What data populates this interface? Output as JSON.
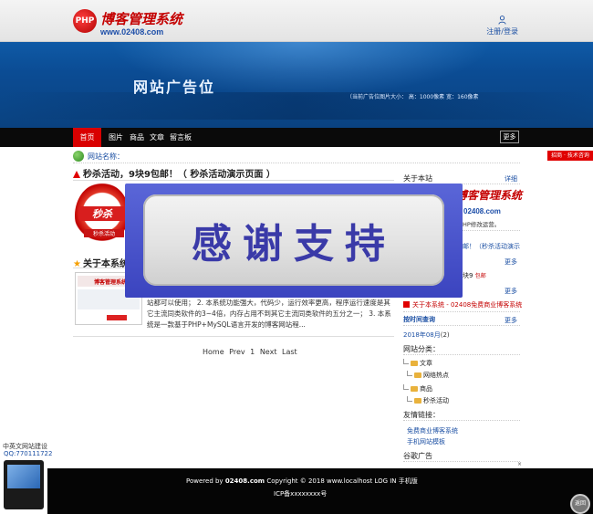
{
  "header": {
    "logo_badge": "PHP",
    "logo_title": "博客管理系统",
    "logo_url": "www.02408.com",
    "login": "注册/登录"
  },
  "banner": {
    "title": "网站广告位",
    "info": "（当前广告位图片大小：   高：1000像素     宽：160像素"
  },
  "nav": {
    "items": [
      "首页",
      "图片",
      "商品",
      "文章",
      "留言板"
    ],
    "more": "更多"
  },
  "breadcrumb": {
    "label": "网站名称：",
    "ad": "招商 · 技术咨询"
  },
  "article": {
    "title": "秒杀活动，9块9包邮！（ 秒杀活动演示页面 ）",
    "seckill_big": "秒杀",
    "seckill_small": "秒杀活动",
    "about_title": "关于本系统",
    "about_text": "站都可以使用； 2. 本系统功能强大，代码少，运行效率更高，程序运行速度是其它主流同类软件的3~4倍，内存占用不到其它主流同类软件的五分之一； 3. 本系统是一款基于PHP+MySQL语言开发的博客网站程..."
  },
  "pager": {
    "home": "Home",
    "prev": "Prev",
    "page": "1",
    "next": "Next",
    "last": "Last"
  },
  "popup": {
    "text": "感谢支持"
  },
  "sidebar": {
    "about_head": "关于本站",
    "about_more": "详细",
    "logo_title": "博客管理系统",
    "logo_url": "02408.com",
    "note": "HP修改运营。",
    "link_seckill": "邮！（秒杀活动演示",
    "more1": "更多",
    "link_nine": "块9",
    "link_nine_tag": "包邮",
    "more2": "更多",
    "link_about": "关于本系统 - 02408免费商业博客系统",
    "time_head": "按时间查询",
    "more3": "更多",
    "month": "2018年08月",
    "month_count": "(2)",
    "cat_head": "网站分类：",
    "cat1": "文章",
    "cat1_sub": "网络热点",
    "cat2": "商品",
    "cat2_sub": "秒杀活动",
    "links_head": "友情链接：",
    "link1": "免费商业博客系统",
    "link2": "手机网站模板",
    "ad_head": "谷歌广告"
  },
  "float_badge": {
    "line1": "中英文网站建设",
    "line2": "QQ:770111722"
  },
  "footer": {
    "powered": "Powered by",
    "site": "02408.com",
    "copyright": "Copyright © 2018",
    "host": "www.localhost",
    "login": "LOG IN",
    "mobile": "手机版",
    "icp": "ICP备xxxxxxxx号"
  },
  "totop": {
    "label": "返回"
  }
}
